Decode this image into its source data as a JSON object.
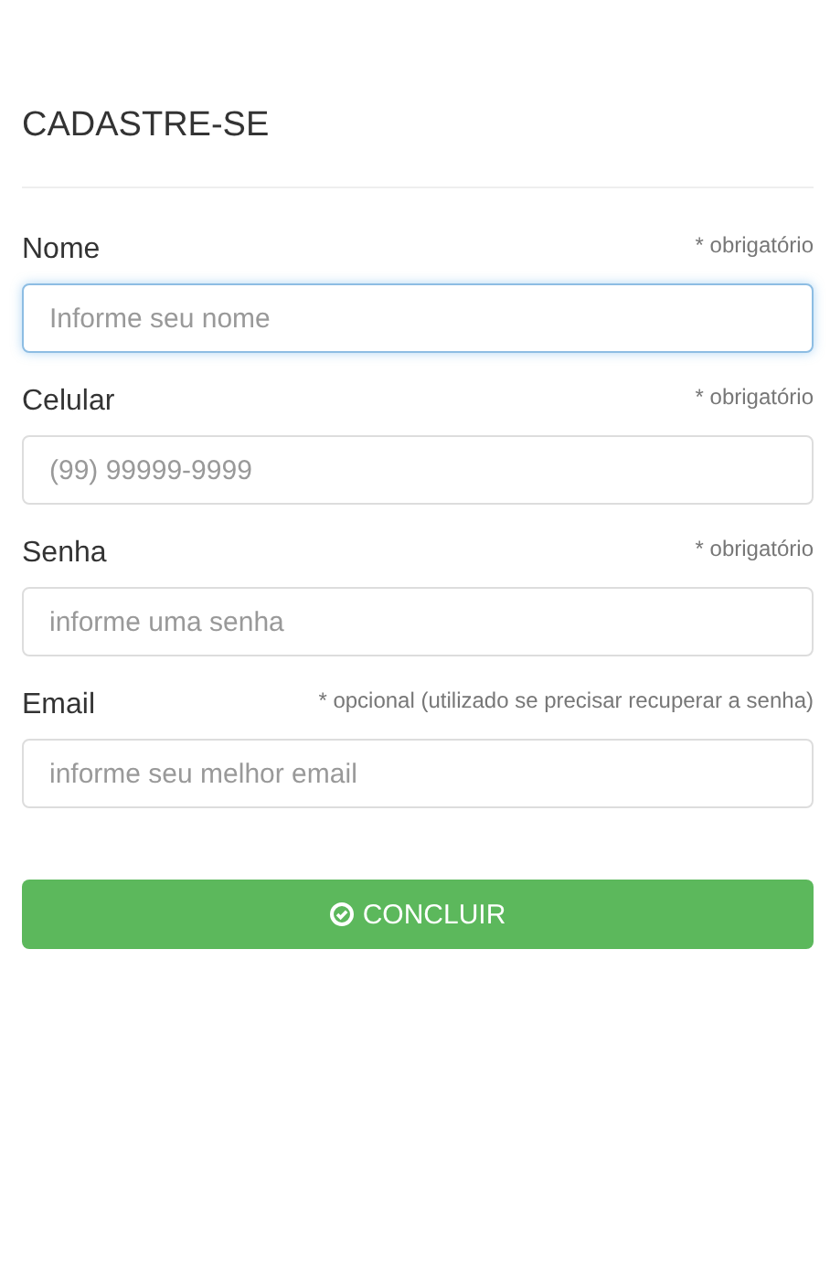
{
  "title": "CADASTRE-SE",
  "fields": [
    {
      "label": "Nome",
      "note": "* obrigatório",
      "placeholder": "Informe seu nome",
      "focused": true
    },
    {
      "label": "Celular",
      "note": "* obrigatório",
      "placeholder": "(99) 99999-9999",
      "focused": false
    },
    {
      "label": "Senha",
      "note": "* obrigatório",
      "placeholder": "informe uma senha",
      "focused": false
    },
    {
      "label": "Email",
      "note": "* opcional (utilizado se precisar recuperar a senha)",
      "placeholder": "informe seu melhor email",
      "focused": false
    }
  ],
  "submit": {
    "label": "CONCLUIR"
  }
}
